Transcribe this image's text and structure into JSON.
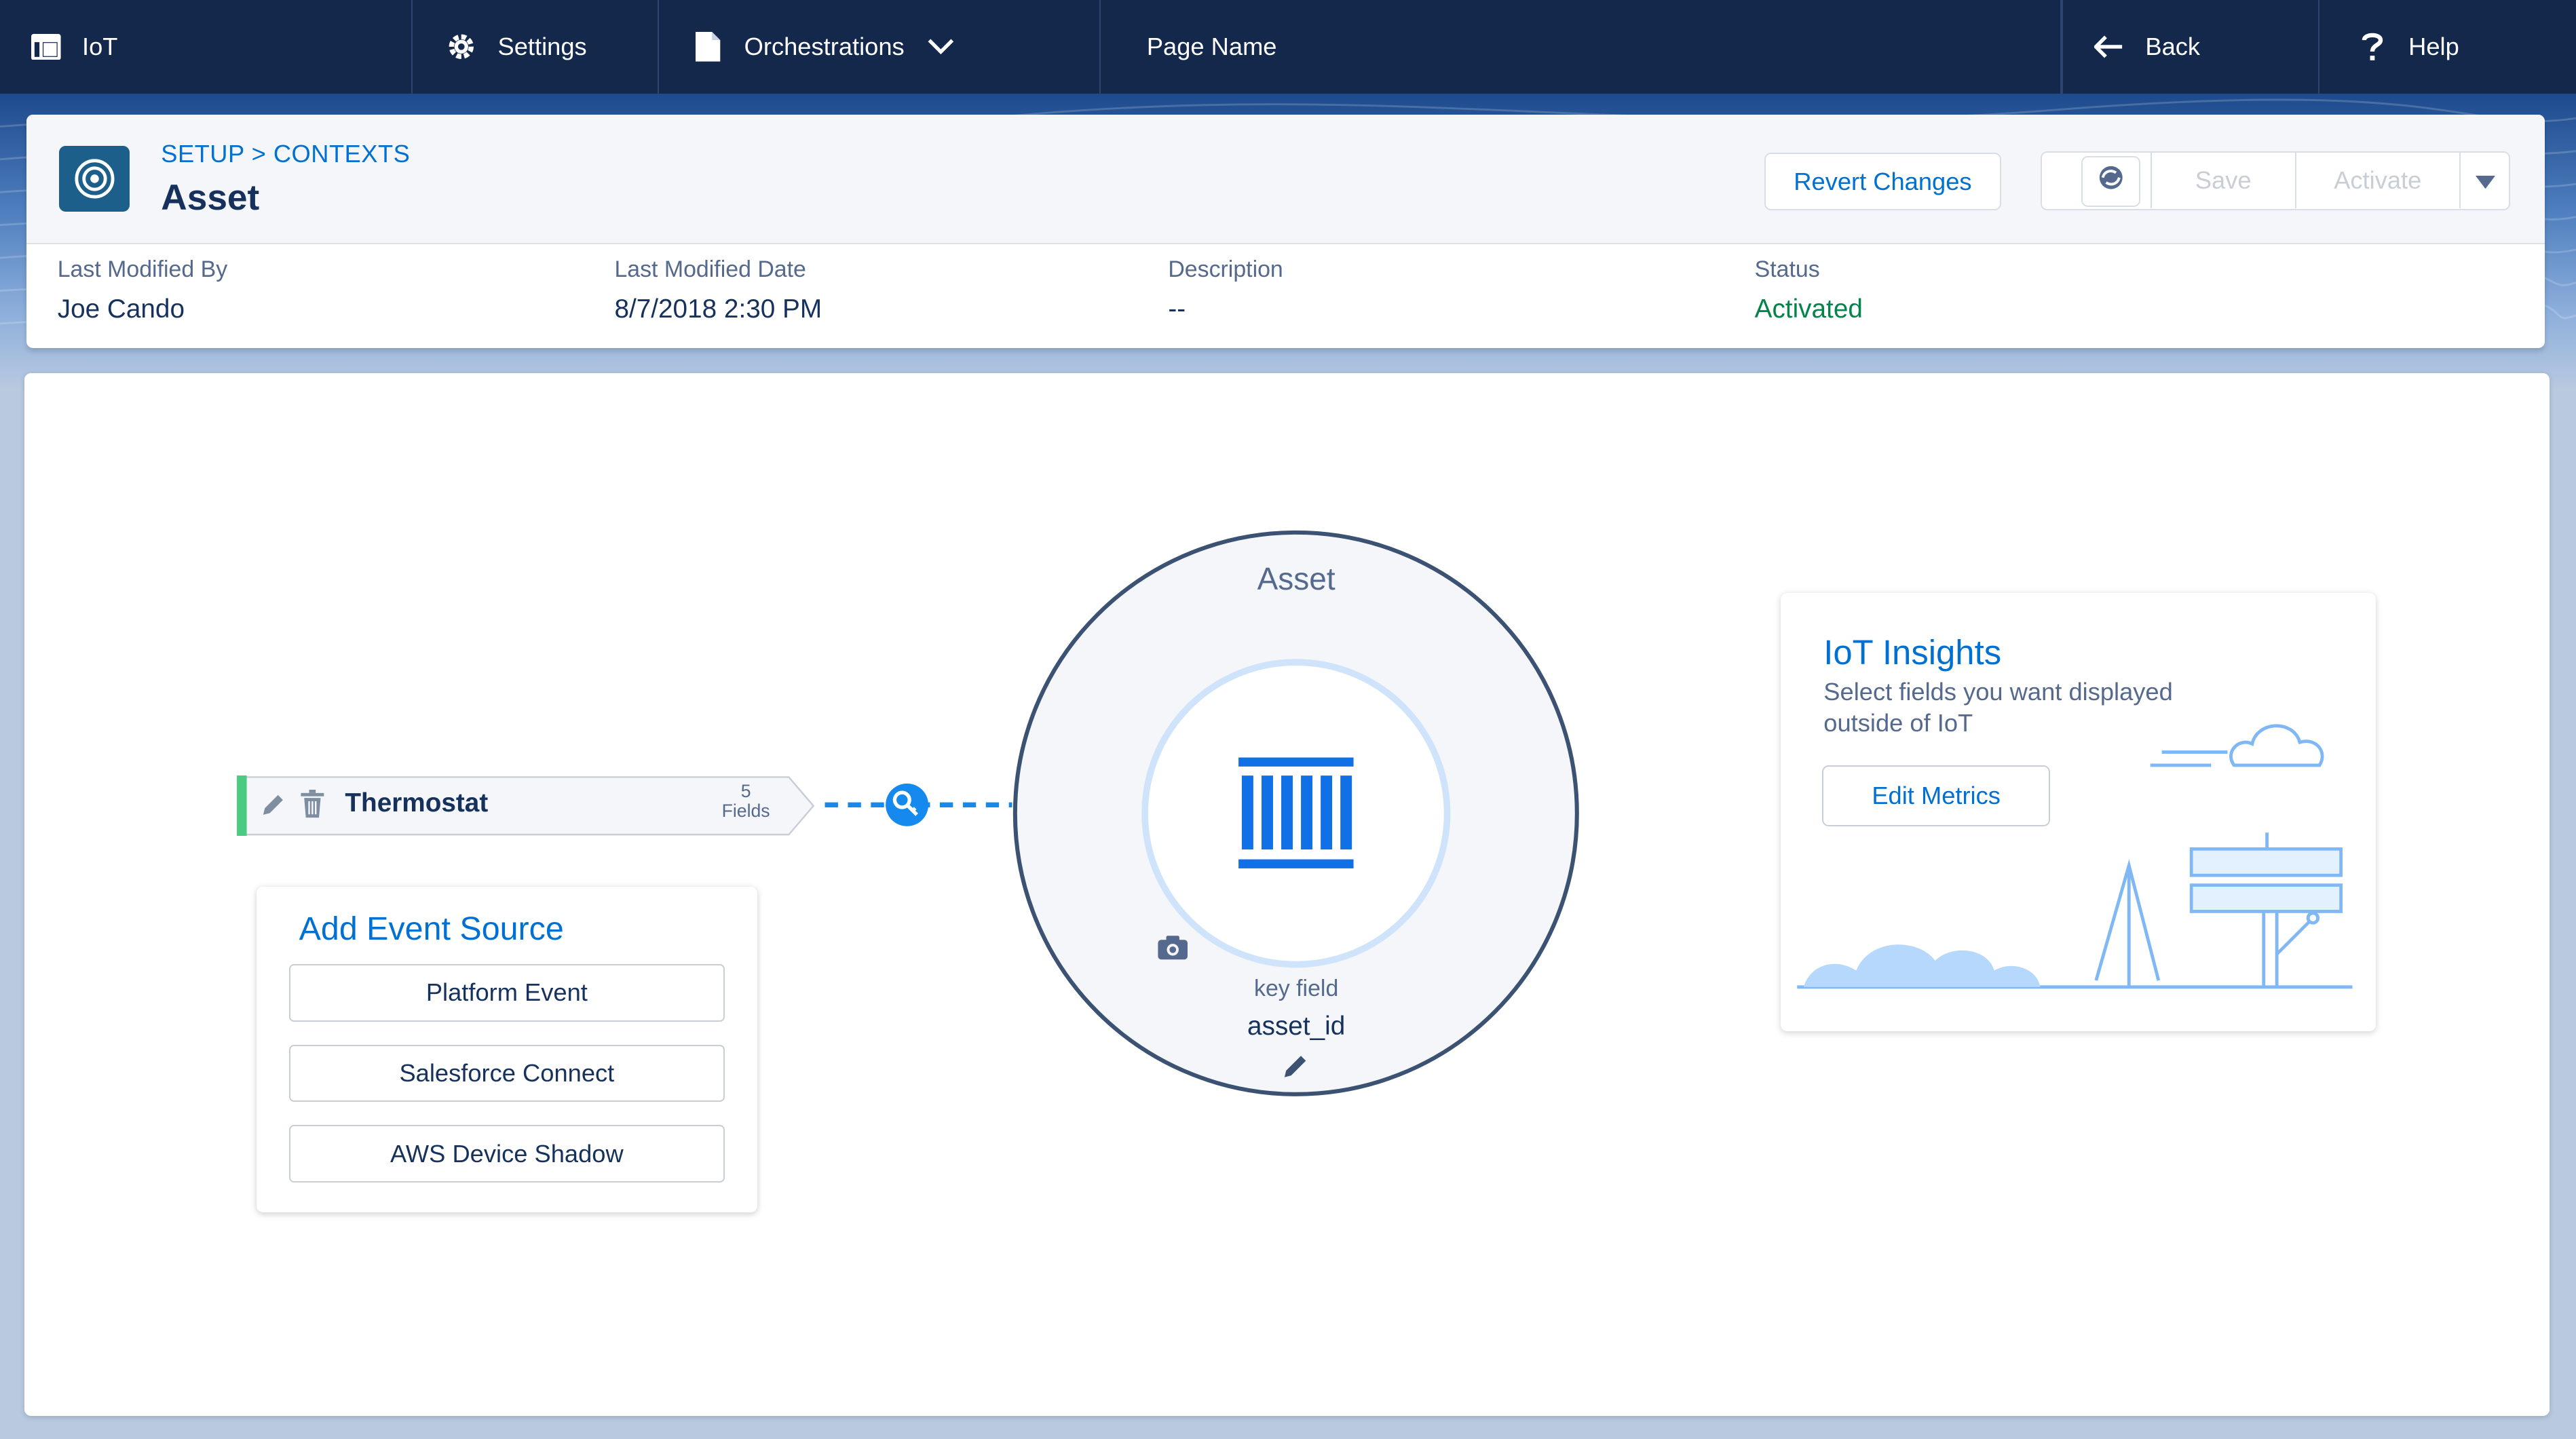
{
  "nav": {
    "app_label": "IoT",
    "settings_label": "Settings",
    "orchestrations_label": "Orchestrations",
    "page_name": "Page Name",
    "back_label": "Back",
    "help_label": "Help"
  },
  "header": {
    "breadcrumb": "SETUP > CONTEXTS",
    "title": "Asset",
    "revert_label": "Revert Changes",
    "save_label": "Save",
    "activate_label": "Activate",
    "fields": [
      {
        "label": "Last Modified By",
        "value": "Joe Cando"
      },
      {
        "label": "Last Modified Date",
        "value": "8/7/2018 2:30 PM"
      },
      {
        "label": "Description",
        "value": "--"
      },
      {
        "label": "Status",
        "value": "Activated"
      }
    ]
  },
  "canvas": {
    "source": {
      "name": "Thermostat",
      "field_count": "5",
      "field_label": "Fields"
    },
    "add_event_source": {
      "title": "Add Event Source",
      "options": [
        "Platform Event",
        "Salesforce Connect",
        "AWS Device Shadow"
      ]
    },
    "context": {
      "name": "Asset",
      "key_field_label": "key field",
      "key_field_value": "asset_id"
    },
    "insights": {
      "title": "IoT Insights",
      "description": "Select fields you want displayed outside of IoT",
      "button_label": "Edit Metrics"
    }
  },
  "colors": {
    "nav_bg": "#14284b",
    "link_blue": "#0070d2",
    "status_green": "#04844b",
    "source_accent": "#4bca81"
  }
}
